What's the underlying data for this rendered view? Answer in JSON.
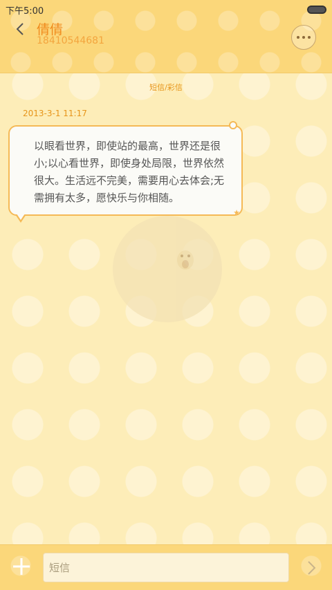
{
  "status_bar": {
    "time": "下午5:00"
  },
  "header": {
    "contact_name": "倩倩",
    "contact_number": "18410544681",
    "back_icon": "chevron-left-icon",
    "more_icon": "more-dots-icon"
  },
  "conversation": {
    "type_label": "短信/彩信",
    "messages": [
      {
        "timestamp": "2013-3-1 11:17",
        "text": "以眼看世界，即使站的最高，世界还是很小;以心看世界，即使身处局限，世界依然很大。生活远不完美，需要用心去体会;无需拥有太多，愿快乐与你相随。"
      }
    ]
  },
  "composer": {
    "placeholder": "短信",
    "add_icon": "plus-icon",
    "send_icon": "chevron-right-icon"
  },
  "colors": {
    "accent": "#f08a1c",
    "header_bg": "#fbd77a",
    "page_bg": "#fdedb8",
    "bubble_border": "#f5b956"
  }
}
